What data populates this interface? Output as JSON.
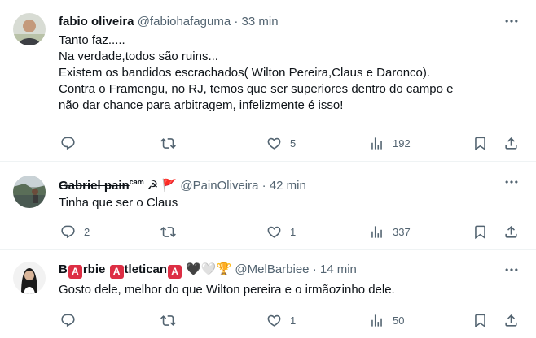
{
  "tweets": [
    {
      "name": "fabio oliveira",
      "handle": "@fabiohafaguma",
      "sep": "·",
      "time": "33 min",
      "lines": [
        "Tanto faz.....",
        "Na verdade,todos são ruins...",
        "Existem os bandidos escrachados( Wilton Pereira,Claus e Daronco).",
        "Contra o Framengu, no RJ, temos que ser superiores dentro do campo e",
        "não dar chance para arbitragem, infelizmente é isso!"
      ],
      "replies": "",
      "retweets": "",
      "likes": "5",
      "views": "192"
    },
    {
      "name": "Gabriel pain",
      "name_sup": "cam",
      "name_emoji": "☭ 🚩",
      "handle": "@PainOliveira",
      "sep": "·",
      "time": "42 min",
      "lines": [
        "Tinha que ser o Claus"
      ],
      "replies": "2",
      "retweets": "",
      "likes": "1",
      "views": "337"
    },
    {
      "name_parts": [
        "B",
        "A",
        "rbie ",
        "A",
        "tletican",
        "A"
      ],
      "name_emoji": "🖤🤍🏆",
      "handle": "@MelBarbiee",
      "sep": "·",
      "time": "14 min",
      "lines": [
        "Gosto dele, melhor do que Wilton pereira e o irmãozinho dele."
      ],
      "replies": "",
      "retweets": "",
      "likes": "1",
      "views": "50"
    }
  ],
  "icons": {
    "reply": "reply-icon",
    "retweet": "retweet-icon",
    "like": "heart-icon",
    "views": "views-icon",
    "bookmark": "bookmark-icon",
    "share": "share-icon",
    "more": "more-icon"
  },
  "colors": {
    "text": "#0f1419",
    "secondary": "#536471",
    "badge": "#dd2e44",
    "divider": "#eff3f4"
  }
}
